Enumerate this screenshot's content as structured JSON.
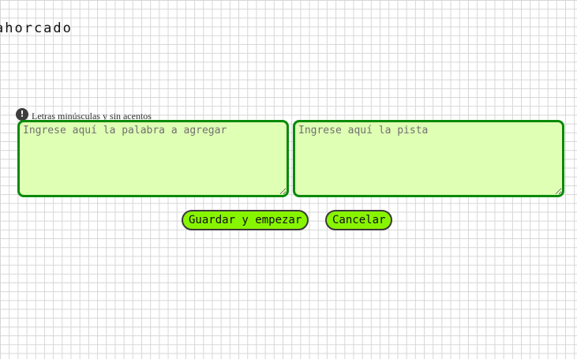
{
  "header": {
    "logo_text": "ahorcado"
  },
  "form": {
    "hint_text": "Letras minúsculas y sin acentos",
    "hint_icon": "exclamation-circle-icon",
    "word_placeholder": "Ingrese aquí la palabra a agregar",
    "word_value": "",
    "clue_placeholder": "Ingrese aquí la pista",
    "clue_value": ""
  },
  "actions": {
    "save_label": "Guardar y empezar",
    "cancel_label": "Cancelar"
  },
  "colors": {
    "textarea_bg": "#dfffb4",
    "textarea_border": "#0a8a0a",
    "button_bg": "#88f500"
  }
}
